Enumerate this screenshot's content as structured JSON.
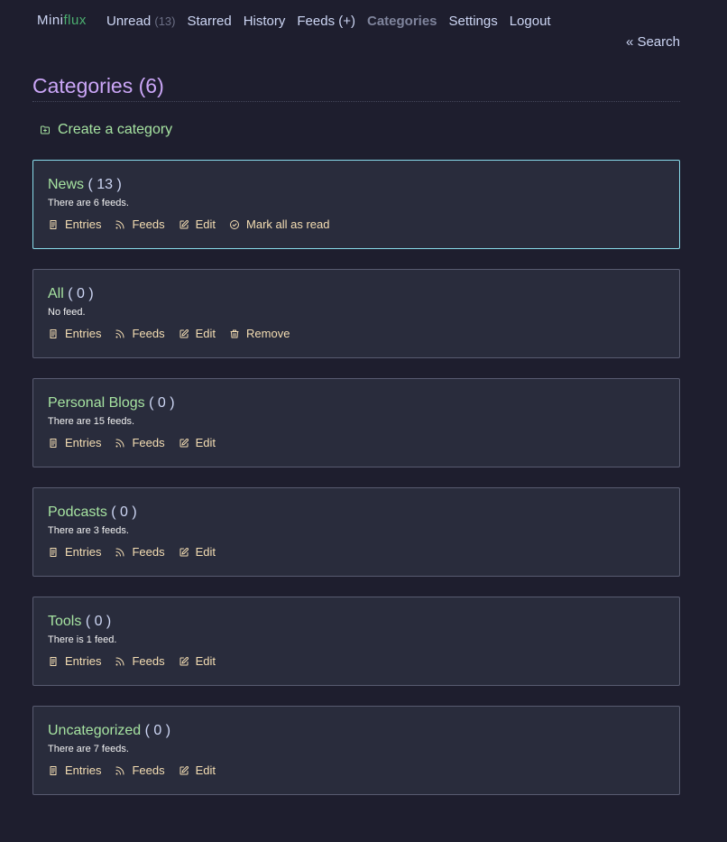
{
  "header": {
    "logo_mini": "Mini",
    "logo_flux": "flux",
    "nav": [
      {
        "label": "Unread",
        "count": "(13)"
      },
      {
        "label": "Starred"
      },
      {
        "label": "History"
      },
      {
        "label": "Feeds (+)"
      },
      {
        "label": "Categories",
        "active": true
      },
      {
        "label": "Settings"
      },
      {
        "label": "Logout"
      }
    ],
    "search_label": "« Search"
  },
  "page": {
    "title": "Categories (6)",
    "create_label": "Create a category"
  },
  "categories": [
    {
      "name": "News",
      "count": "( 13 )",
      "desc": "There are 6 feeds.",
      "actions": [
        "Entries",
        "Feeds",
        "Edit",
        "Mark all as read"
      ]
    },
    {
      "name": "All",
      "count": "( 0 )",
      "desc": "No feed.",
      "actions": [
        "Entries",
        "Feeds",
        "Edit",
        "Remove"
      ]
    },
    {
      "name": "Personal Blogs",
      "count": "( 0 )",
      "desc": "There are 15 feeds.",
      "actions": [
        "Entries",
        "Feeds",
        "Edit"
      ]
    },
    {
      "name": "Podcasts",
      "count": "( 0 )",
      "desc": "There are 3 feeds.",
      "actions": [
        "Entries",
        "Feeds",
        "Edit"
      ]
    },
    {
      "name": "Tools",
      "count": "( 0 )",
      "desc": "There is 1 feed.",
      "actions": [
        "Entries",
        "Feeds",
        "Edit"
      ]
    },
    {
      "name": "Uncategorized",
      "count": "( 0 )",
      "desc": "There are 7 feeds.",
      "actions": [
        "Entries",
        "Feeds",
        "Edit"
      ]
    }
  ],
  "icons": {
    "create": "folder-plus-icon",
    "Entries": "file-text-icon",
    "Feeds": "rss-icon",
    "Edit": "edit-icon",
    "Mark all as read": "check-circle-icon",
    "Remove": "trash-icon"
  },
  "colors": {
    "background": "#1e1e2e",
    "card": "#292c3c",
    "title": "#cba6f7",
    "link_green": "#a6e3a1",
    "action": "#f5deb3",
    "focus_border": "#89dceb"
  }
}
